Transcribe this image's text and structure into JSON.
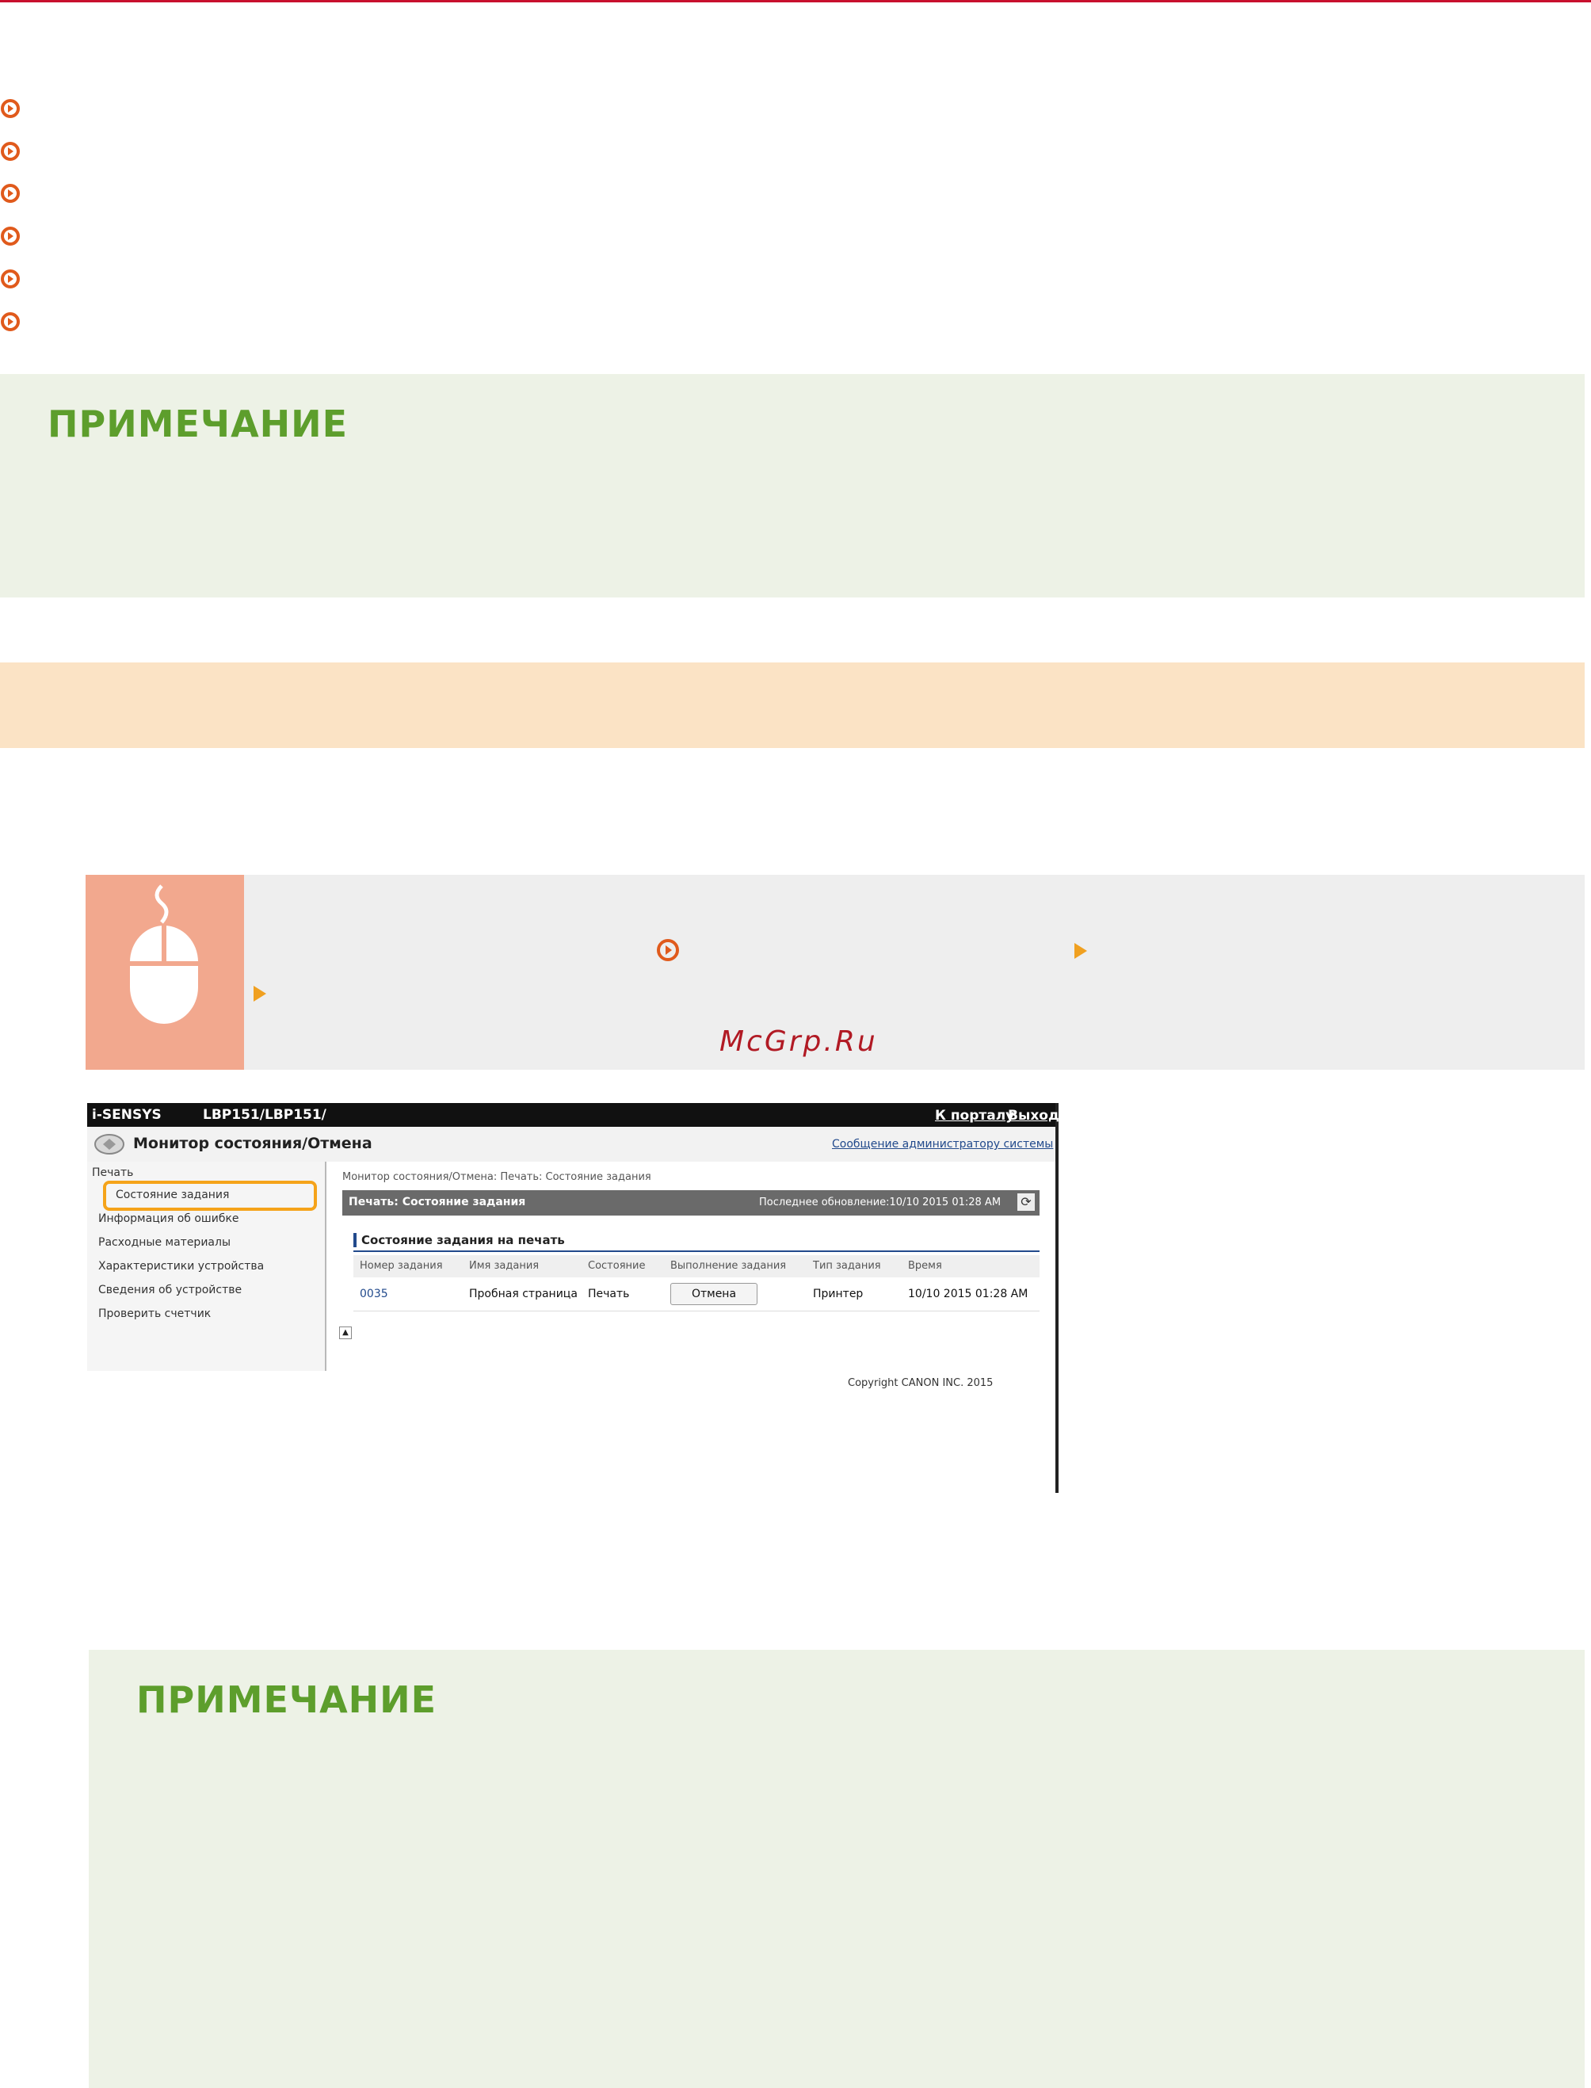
{
  "colors": {
    "rule": "#c8102e",
    "link_icon": "#e05a1c",
    "note_bg": "#edf2e6",
    "note_title": "#5d9e2c",
    "band": "#fbe3c5",
    "mouse_panel": "#f2a88e",
    "arrow": "#f0a020"
  },
  "links": [
    {
      "icon": "circle-arrow-icon"
    },
    {
      "icon": "circle-arrow-icon"
    },
    {
      "icon": "circle-arrow-icon"
    },
    {
      "icon": "circle-arrow-icon"
    },
    {
      "icon": "circle-arrow-icon"
    },
    {
      "icon": "circle-arrow-icon"
    }
  ],
  "note1": {
    "title": "ПРИМЕЧАНИЕ"
  },
  "note2": {
    "title": "ПРИМЕЧАНИЕ"
  },
  "step": {
    "icon": "mouse-icon",
    "watermark": "McGrp.Ru"
  },
  "screenshot": {
    "brand": "i-SENSYS",
    "model": "LBP151/LBP151/",
    "portal_link": "К порталу",
    "logout_link": "Выход",
    "header_title": "Монитор состояния/Отмена",
    "admin_link": "Сообщение администратору системы",
    "menu_group": "Печать",
    "menu": [
      "Состояние задания",
      "Информация об ошибке",
      "Расходные материалы",
      "Характеристики устройства",
      "Сведения об устройстве",
      "Проверить счетчик"
    ],
    "breadcrumb": "Монитор состояния/Отмена: Печать: Состояние задания",
    "bar_title": "Печать: Состояние задания",
    "last_update": "Последнее обновление:10/10 2015 01:28 AM",
    "section_title": "Состояние задания на печать",
    "columns": [
      "Номер задания",
      "Имя задания",
      "Состояние",
      "Выполнение задания",
      "Тип задания",
      "Время"
    ],
    "row": {
      "job_no": "0035",
      "name": "Пробная страница",
      "status": "Печать",
      "action": "Отмена",
      "type": "Принтер",
      "time": "10/10 2015 01:28 AM"
    },
    "copyright": "Copyright CANON INC. 2015"
  }
}
